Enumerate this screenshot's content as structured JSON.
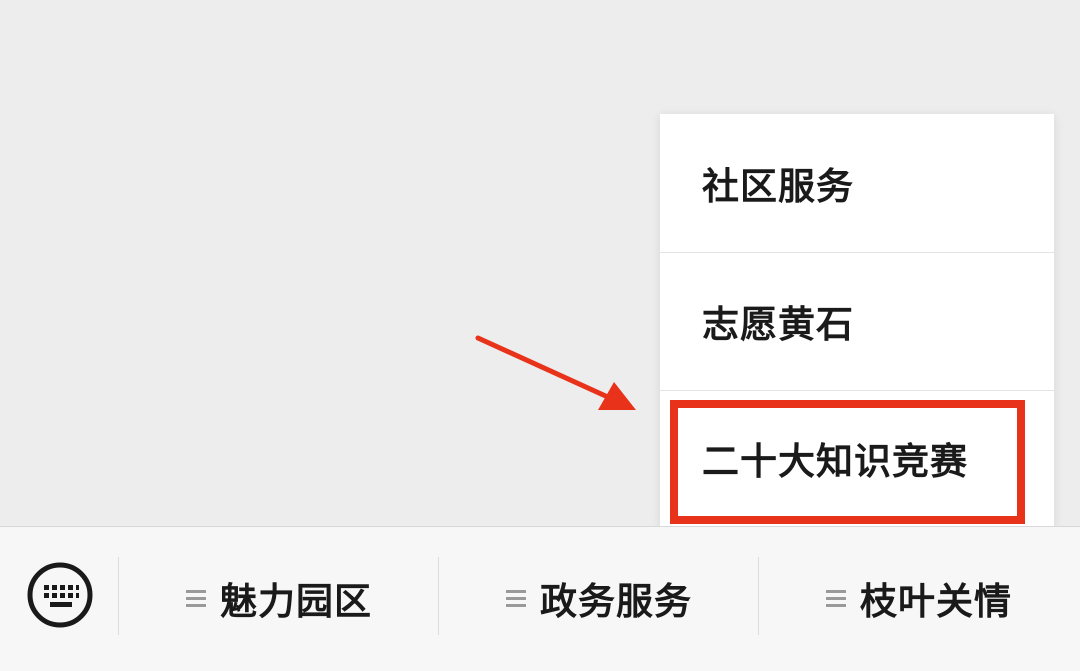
{
  "popup": {
    "items": [
      {
        "label": "社区服务"
      },
      {
        "label": "志愿黄石"
      },
      {
        "label": "二十大知识竞赛"
      }
    ]
  },
  "annotation": {
    "highlight_color": "#e8321a",
    "arrow_color": "#e8321a",
    "highlighted_item": "二十大知识竞赛"
  },
  "menubar": {
    "keyboard_icon": "keyboard-icon",
    "items": [
      {
        "label": "魅力园区",
        "icon": "menu-lines-icon"
      },
      {
        "label": "政务服务",
        "icon": "menu-lines-icon"
      },
      {
        "label": "枝叶关情",
        "icon": "menu-lines-icon"
      }
    ]
  },
  "colors": {
    "background": "#ededed",
    "menubar_background": "#f7f7f7",
    "popup_background": "#ffffff",
    "text": "#1a1a1a"
  }
}
